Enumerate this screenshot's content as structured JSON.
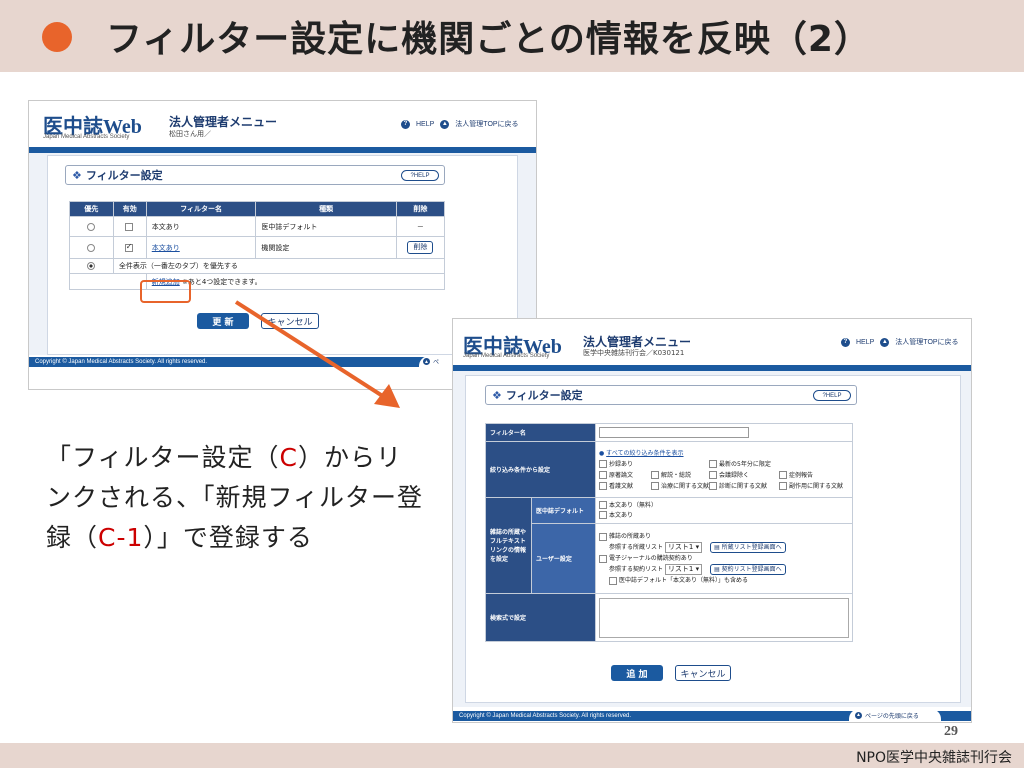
{
  "slide": {
    "title": "フィルター設定に機関ごとの情報を反映（2）",
    "caption_a": "「フィルター設定（",
    "caption_b": "C",
    "caption_c": "）からリンクされる、「新規フィルター登録（",
    "caption_d": "C-1",
    "caption_e": "）」で登録する",
    "footer_org": "NPO医学中央雑誌刊行会",
    "page_number": "29",
    "accent_color": "#e8642b",
    "header_bg": "#e7d6cf"
  },
  "shot_a": {
    "logo": "医中誌Web",
    "logo_sub": "Japan Medical Abstracts Society",
    "menu_title": "法人管理者メニュー",
    "menu_sub": "松田さん用／",
    "help": "HELP",
    "top_link": "法人管理TOPに戻る",
    "section_title": "フィルター設定",
    "help_pill": "HELP",
    "headers": [
      "優先",
      "有効",
      "フィルター名",
      "種類",
      "削除"
    ],
    "rows": [
      {
        "name": "本文あり",
        "type": "医中誌デフォルト",
        "del": "－",
        "checked": false
      },
      {
        "name": "本文あり",
        "type": "機関設定",
        "del": "削除",
        "checked": true
      }
    ],
    "all_display": "全件表示（一番左のタブ）を優先する",
    "new_link": "新規追加",
    "note": "※あと4つ設定できます。",
    "update_button": "更 新",
    "cancel_button": "キャンセル",
    "copyright": "Copyright © Japan Medical Abstracts Society.  All rights reserved.",
    "back_top": "ペ"
  },
  "shot_b": {
    "logo": "医中誌Web",
    "logo_sub": "Japan Medical Abstracts Society",
    "menu_title": "法人管理者メニュー",
    "menu_sub": "医学中央雑誌刊行会／K030121",
    "help": "HELP",
    "top_link": "法人管理TOPに戻る",
    "section_title": "フィルター設定",
    "help_pill": "HELP",
    "filter_name_label": "フィルター名",
    "filter_name_value": "",
    "narrow_label": "絞り込み条件から設定",
    "show_all_link": "すべての絞り込み条件を表示",
    "narrow_row1": [
      "抄録あり",
      "最新の5年分に限定"
    ],
    "narrow_row2": [
      "原著論文",
      "解説・総説",
      "会議録除く",
      "症例報告"
    ],
    "narrow_row3": [
      "看護文献",
      "治療に関する文献",
      "診断に関する文献",
      "副作用に関する文献"
    ],
    "holdings_label": "雑誌の所蔵やフルテキストリンクの情報を設定",
    "default_label": "医中誌デフォルト",
    "default_opts": [
      "本文あり（無料）",
      "本文あり"
    ],
    "user_label": "ユーザー設定",
    "user_journal": "雑誌の所蔵あり",
    "user_ref1": "参照する所蔵リスト",
    "list_value": "リスト1",
    "reg_btn1": "所蔵リスト登録画面へ",
    "user_ejournal": "電子ジャーナルの購読契約あり",
    "user_ref2": "参照する契約リスト",
    "reg_btn2": "契約リスト登録画面へ",
    "include_free": "医中誌デフォルト「本文あり（無料）」も含める",
    "search_label": "検索式で設定",
    "search_value": "",
    "add_button": "追 加",
    "cancel_button": "キャンセル",
    "copyright": "Copyright © Japan Medical Abstracts Society.  All rights reserved.",
    "back_top": "ページの先頭に戻る"
  }
}
